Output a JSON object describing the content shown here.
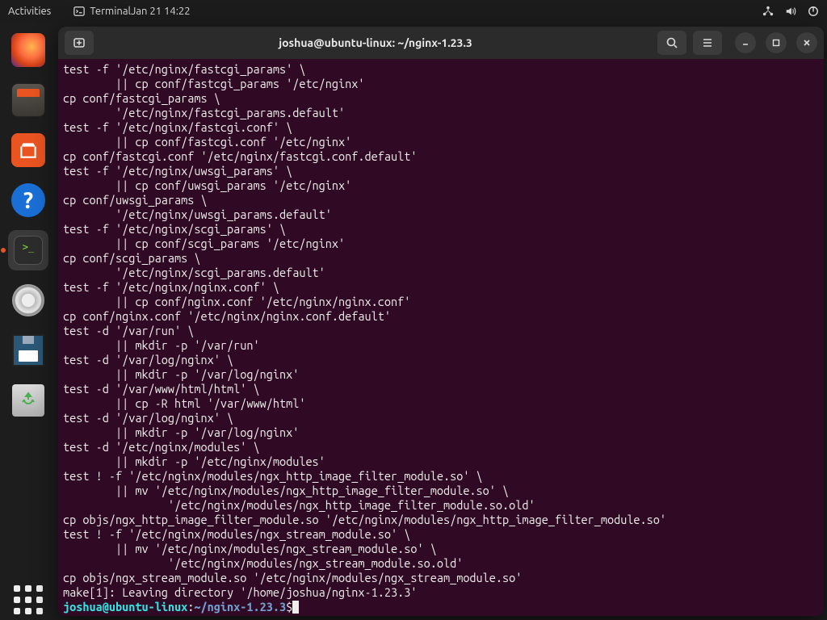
{
  "topbar": {
    "activities": "Activities",
    "app": "Terminal",
    "clock": "Jan 21  14:22"
  },
  "window": {
    "title": "joshua@ubuntu-linux: ~/nginx-1.23.3"
  },
  "prompt": {
    "user": "joshua@ubuntu-linux",
    "sep": ":",
    "path": "~/nginx-1.23.3",
    "sym": "$"
  },
  "lines": [
    "test -f '/etc/nginx/fastcgi_params' \\",
    "        || cp conf/fastcgi_params '/etc/nginx'",
    "cp conf/fastcgi_params \\",
    "        '/etc/nginx/fastcgi_params.default'",
    "test -f '/etc/nginx/fastcgi.conf' \\",
    "        || cp conf/fastcgi.conf '/etc/nginx'",
    "cp conf/fastcgi.conf '/etc/nginx/fastcgi.conf.default'",
    "test -f '/etc/nginx/uwsgi_params' \\",
    "        || cp conf/uwsgi_params '/etc/nginx'",
    "cp conf/uwsgi_params \\",
    "        '/etc/nginx/uwsgi_params.default'",
    "test -f '/etc/nginx/scgi_params' \\",
    "        || cp conf/scgi_params '/etc/nginx'",
    "cp conf/scgi_params \\",
    "        '/etc/nginx/scgi_params.default'",
    "test -f '/etc/nginx/nginx.conf' \\",
    "        || cp conf/nginx.conf '/etc/nginx/nginx.conf'",
    "cp conf/nginx.conf '/etc/nginx/nginx.conf.default'",
    "test -d '/var/run' \\",
    "        || mkdir -p '/var/run'",
    "test -d '/var/log/nginx' \\",
    "        || mkdir -p '/var/log/nginx'",
    "test -d '/var/www/html/html' \\",
    "        || cp -R html '/var/www/html'",
    "test -d '/var/log/nginx' \\",
    "        || mkdir -p '/var/log/nginx'",
    "test -d '/etc/nginx/modules' \\",
    "        || mkdir -p '/etc/nginx/modules'",
    "test ! -f '/etc/nginx/modules/ngx_http_image_filter_module.so' \\",
    "        || mv '/etc/nginx/modules/ngx_http_image_filter_module.so' \\",
    "                '/etc/nginx/modules/ngx_http_image_filter_module.so.old'",
    "cp objs/ngx_http_image_filter_module.so '/etc/nginx/modules/ngx_http_image_filter_module.so'",
    "test ! -f '/etc/nginx/modules/ngx_stream_module.so' \\",
    "        || mv '/etc/nginx/modules/ngx_stream_module.so' \\",
    "                '/etc/nginx/modules/ngx_stream_module.so.old'",
    "cp objs/ngx_stream_module.so '/etc/nginx/modules/ngx_stream_module.so'",
    "make[1]: Leaving directory '/home/joshua/nginx-1.23.3'"
  ]
}
